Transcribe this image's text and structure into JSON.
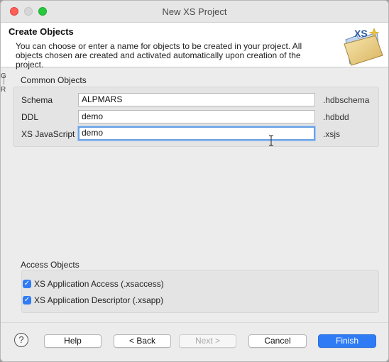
{
  "window": {
    "title": "New XS Project"
  },
  "header": {
    "title": "Create Objects",
    "description": "You can choose or enter a name for objects to be created in your project. All objects chosen are created and activated automatically upon creation of the project.",
    "art_label": "XS"
  },
  "left_strip": {
    "glyph1": "G",
    "glyph2": "R"
  },
  "common_objects": {
    "title": "Common Objects",
    "rows": [
      {
        "label": "Schema",
        "value": "ALPMARS",
        "suffix": ".hdbschema"
      },
      {
        "label": "DDL",
        "value": "demo",
        "suffix": ".hdbdd"
      },
      {
        "label": "XS JavaScript",
        "value": "demo",
        "suffix": ".xsjs"
      }
    ]
  },
  "access_objects": {
    "title": "Access Objects",
    "items": [
      {
        "label": "XS Application Access (.xsaccess)",
        "checked": true
      },
      {
        "label": "XS Application Descriptor (.xsapp)",
        "checked": true
      }
    ]
  },
  "buttons": {
    "help_icon": "?",
    "help": "Help",
    "back": "< Back",
    "next": "Next >",
    "cancel": "Cancel",
    "finish": "Finish"
  },
  "colors": {
    "accent": "#2f7bf5",
    "focus_ring": "#6aa2e6"
  },
  "icons": [
    "close-icon",
    "minimize-icon",
    "zoom-icon",
    "xs-folder-icon",
    "sparkle-icon",
    "checkmark-icon",
    "help-icon",
    "text-cursor-icon"
  ]
}
